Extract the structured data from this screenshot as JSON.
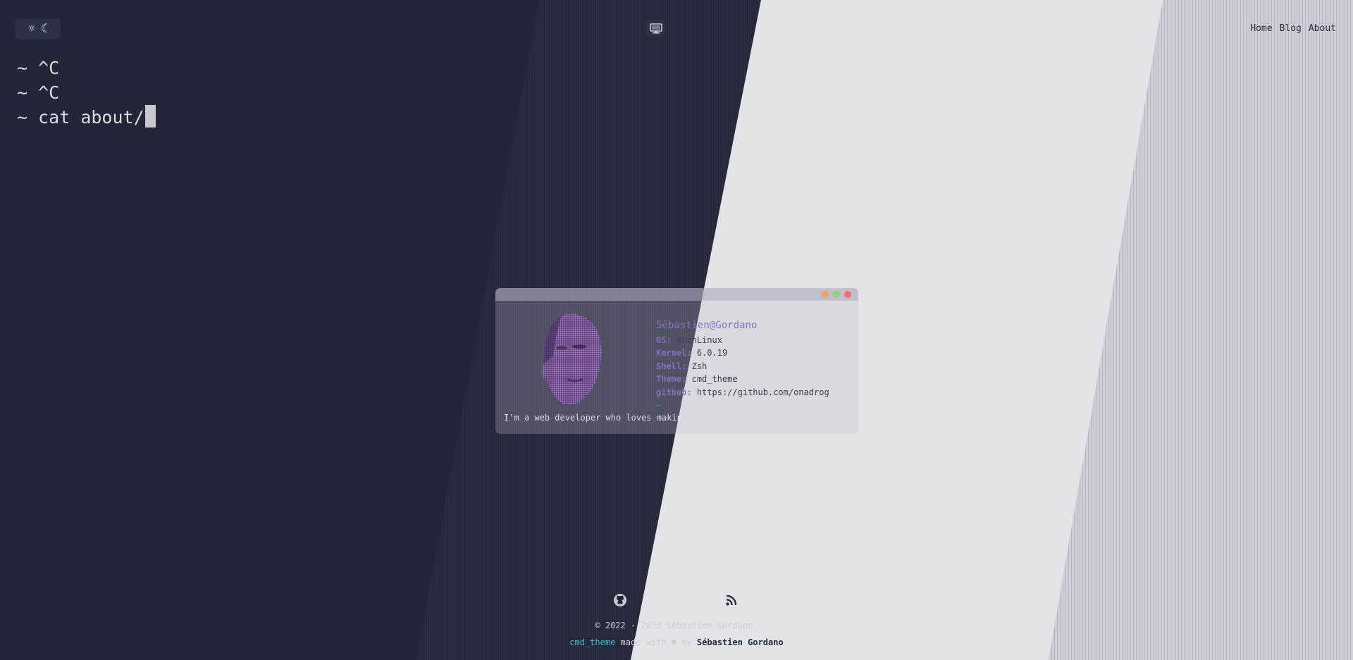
{
  "theme_toggle": {
    "light_icon": "sun-icon",
    "dark_icon": "moon-icon"
  },
  "display_icon": "monitor-icon",
  "nav": {
    "items": [
      {
        "label": "Home"
      },
      {
        "label": "Blog"
      },
      {
        "label": "About"
      }
    ]
  },
  "terminal": {
    "lines": [
      {
        "prompt": "~",
        "text": "^C"
      },
      {
        "prompt": "~",
        "text": "^C"
      },
      {
        "prompt": "~",
        "text": "cat about/"
      }
    ]
  },
  "card": {
    "window_dots": [
      "#f0a35d",
      "#8fd174",
      "#f26b7a"
    ],
    "user": "Sébastien@Gordano",
    "rows": [
      {
        "key": "OS",
        "value": "ArchLinux"
      },
      {
        "key": "Kernel",
        "value": "6.0.19"
      },
      {
        "key": "Shell",
        "value": "Zsh"
      },
      {
        "key": "Theme",
        "value": "cmd_theme"
      },
      {
        "key": "github",
        "value": "https://github.com/onadrog"
      }
    ],
    "prompt_tilde": "~",
    "bio": "I'm a web developer who loves making stuff and woodworking."
  },
  "footer": {
    "github_icon": "github-icon",
    "rss_icon": "rss-icon",
    "copyright": "© 2022 - 2023 Sébastien Gordano.",
    "theme_link": "cmd_theme",
    "made_with": " made with ♥ by ",
    "author": "Sébastien Gordano"
  },
  "colors": {
    "dark_bg": "#232637",
    "light_bg": "#e4e4e8",
    "accent_purple": "#8a6fc1",
    "accent_cyan": "#37bdd2"
  }
}
